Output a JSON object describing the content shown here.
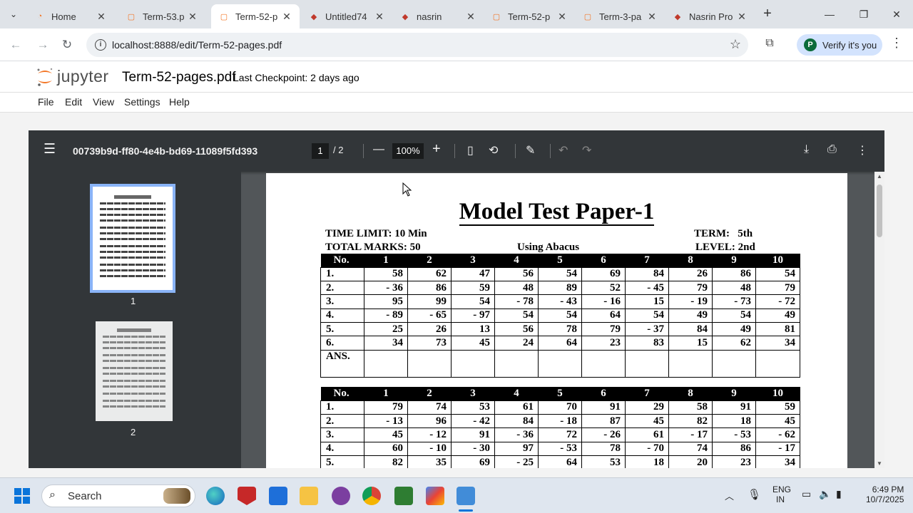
{
  "browser": {
    "tabs": [
      {
        "label": "Home",
        "icon": "jupyter-icon",
        "active": false
      },
      {
        "label": "Term-53.p",
        "icon": "jupyter-file-icon",
        "active": false
      },
      {
        "label": "Term-52-p",
        "icon": "jupyter-file-icon",
        "active": true
      },
      {
        "label": "Untitled74",
        "icon": "notebook-icon",
        "active": false
      },
      {
        "label": "nasrin",
        "icon": "notebook-icon",
        "active": false
      },
      {
        "label": "Term-52-p",
        "icon": "jupyter-file-icon",
        "active": false
      },
      {
        "label": "Term-3-pa",
        "icon": "jupyter-file-icon",
        "active": false
      },
      {
        "label": "Nasrin Pro",
        "icon": "notebook-icon",
        "active": false
      }
    ],
    "new_tab": "+",
    "url": "localhost:8888/edit/Term-52-pages.pdf",
    "profile_button": "Verify it's you",
    "profile_initial": "P"
  },
  "jupyter": {
    "logo_text": "jupyter",
    "doc_title": "Term-52-pages.pdf",
    "checkpoint": "Last Checkpoint: 2 days ago",
    "menu": [
      "File",
      "Edit",
      "View",
      "Settings",
      "Help"
    ]
  },
  "pdf_viewer": {
    "file_id": "00739b9d-ff80-4e4b-bd69-11089f5fd393",
    "current_page": "1",
    "page_total": "/ 2",
    "zoom": "100%",
    "thumbnails": [
      "1",
      "2"
    ]
  },
  "page": {
    "title": "Model Test Paper-1",
    "time_limit": "TIME LIMIT: 10 Min",
    "total_marks": "TOTAL MARKS: 50",
    "using": "Using Abacus",
    "term": "TERM:   5th",
    "level": "LEVEL: 2nd",
    "table1": {
      "header": [
        "No.",
        "1",
        "2",
        "3",
        "4",
        "5",
        "6",
        "7",
        "8",
        "9",
        "10"
      ],
      "rows": [
        [
          "1.",
          "58",
          "62",
          "47",
          "56",
          "54",
          "69",
          "84",
          "26",
          "86",
          "54"
        ],
        [
          "2.",
          "- 36",
          "86",
          "59",
          "48",
          "89",
          "52",
          "- 45",
          "79",
          "48",
          "79"
        ],
        [
          "3.",
          "95",
          "99",
          "54",
          "- 78",
          "- 43",
          "- 16",
          "15",
          "- 19",
          "- 73",
          "- 72"
        ],
        [
          "4.",
          "- 89",
          "- 65",
          "- 97",
          "54",
          "54",
          "64",
          "54",
          "49",
          "54",
          "49"
        ],
        [
          "5.",
          "25",
          "26",
          "13",
          "56",
          "78",
          "79",
          "- 37",
          "84",
          "49",
          "81"
        ],
        [
          "6.",
          "34",
          "73",
          "45",
          "24",
          "64",
          "23",
          "83",
          "15",
          "62",
          "34"
        ]
      ],
      "ans_label": "ANS."
    },
    "table2": {
      "header": [
        "No.",
        "1",
        "2",
        "3",
        "4",
        "5",
        "6",
        "7",
        "8",
        "9",
        "10"
      ],
      "rows": [
        [
          "1.",
          "79",
          "74",
          "53",
          "61",
          "70",
          "91",
          "29",
          "58",
          "91",
          "59"
        ],
        [
          "2.",
          "- 13",
          "96",
          "- 42",
          "84",
          "- 18",
          "87",
          "45",
          "82",
          "18",
          "45"
        ],
        [
          "3.",
          "45",
          "- 12",
          "91",
          "- 36",
          "72",
          "- 26",
          "61",
          "- 17",
          "- 53",
          "- 62"
        ],
        [
          "4.",
          "60",
          "- 10",
          "- 30",
          "97",
          "- 53",
          "78",
          "- 70",
          "74",
          "86",
          "- 17"
        ],
        [
          "5.",
          "82",
          "35",
          "69",
          "- 25",
          "64",
          "53",
          "18",
          "20",
          "23",
          "34"
        ]
      ]
    }
  },
  "taskbar": {
    "search_label": "Search",
    "lang": "ENG",
    "region": "IN",
    "time": "6:49 PM",
    "date": "10/7/2025"
  }
}
